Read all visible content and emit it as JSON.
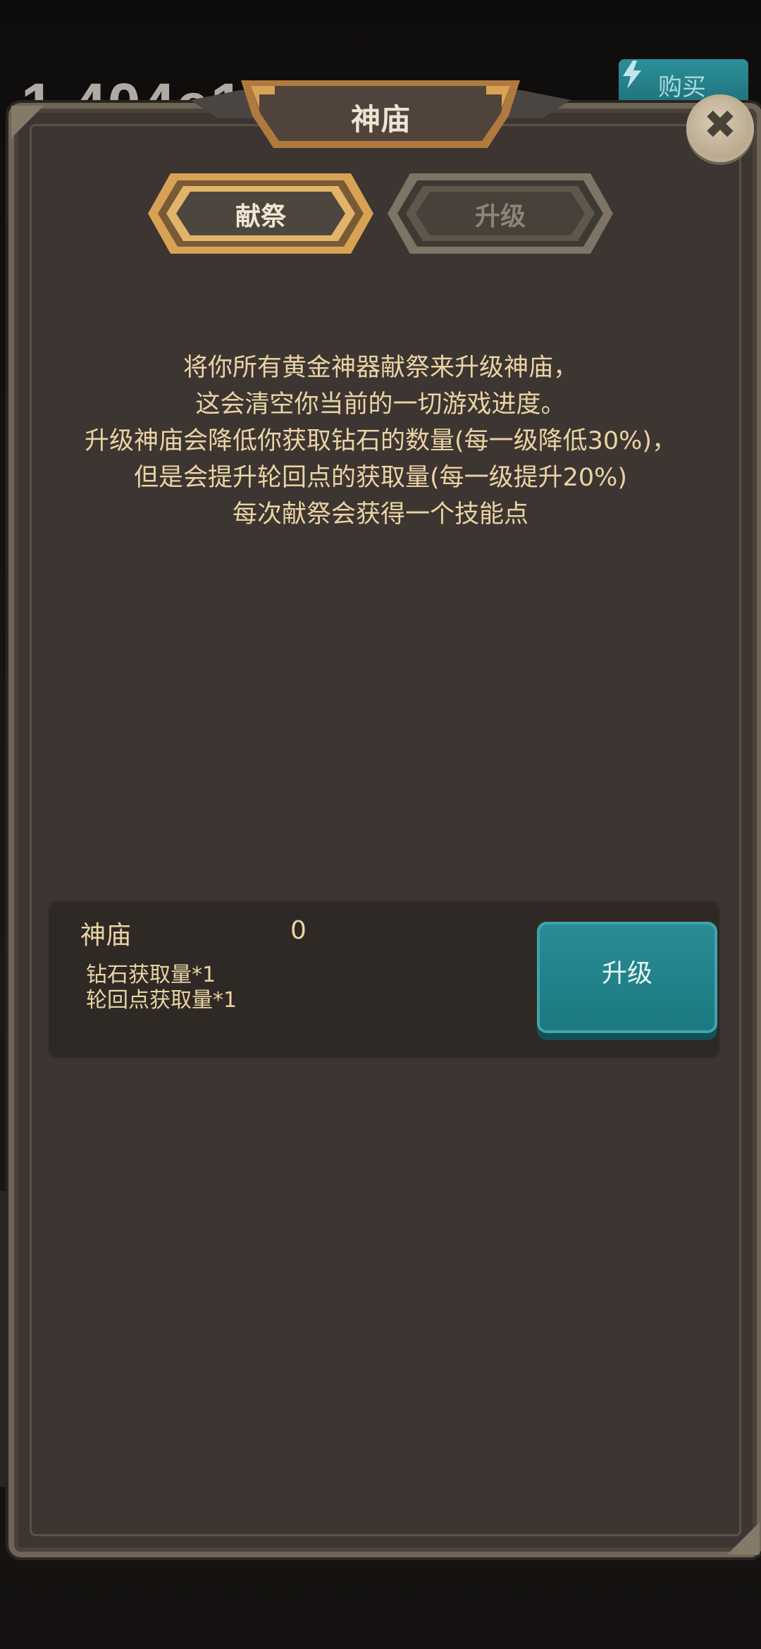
{
  "background": {
    "currency_value": "1.404e1",
    "buy_label": "购买"
  },
  "modal": {
    "title": "神庙",
    "close_glyph": "✖",
    "tabs": [
      {
        "label": "献祭",
        "active": true
      },
      {
        "label": "升级",
        "active": false
      }
    ],
    "description": [
      "将你所有黄金神器献祭来升级神庙，",
      "这会清空你当前的一切游戏进度。",
      "升级神庙会降低你获取钻石的数量(每一级降低30%)，",
      "但是会提升轮回点的获取量(每一级提升20%)",
      "每次献祭会获得一个技能点"
    ],
    "card": {
      "name": "神庙",
      "level": "0",
      "stats": [
        "钻石获取量*1",
        "轮回点获取量*1"
      ],
      "upgrade_label": "升级"
    }
  },
  "colors": {
    "panel": "#3c3531",
    "text_gold": "#ead3a4",
    "button_teal": "#1b7880",
    "tab_gold": "#d8a255"
  },
  "icons": {
    "close": "close-icon",
    "buy": "lightning-icon"
  }
}
